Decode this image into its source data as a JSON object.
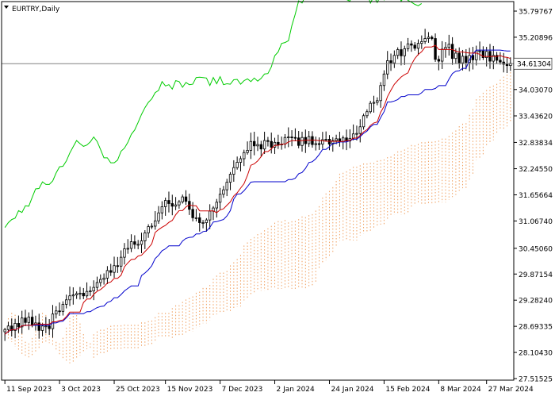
{
  "symbol_label": "EURTRY,Daily",
  "colors": {
    "background": "#ffffff",
    "frame": "#000000",
    "candle_up": "#000000",
    "candle_down": "#000000",
    "tenkan": "#cc0000",
    "kijun": "#0000cc",
    "chikou": "#00cc00",
    "cloud_bull": "#f0a060",
    "cloud_bear": "#c8a8d8",
    "current_price_line": "#808080",
    "price_box": "#ffffff"
  },
  "chart_data": {
    "type": "candlestick",
    "title": "EURTRY,Daily",
    "indicator": "Ichimoku Kinko Hyo",
    "grid": false,
    "current_price": 34.61304,
    "ylim": [
      27.51525,
      35.79767
    ],
    "y_ticks": [
      "35.79767",
      "35.20896",
      "34.61304",
      "34.03070",
      "33.43620",
      "32.83834",
      "32.24550",
      "31.65664",
      "31.06740",
      "30.45060",
      "29.87154",
      "29.28240",
      "28.69335",
      "28.10430",
      "27.51525"
    ],
    "y_tick_values": [
      35.79767,
      35.20896,
      34.61304,
      34.0307,
      33.4362,
      32.83834,
      32.2455,
      31.65664,
      31.0674,
      30.4506,
      29.87154,
      29.2824,
      28.69335,
      28.1043,
      27.51525
    ],
    "x_ticks": [
      "11 Sep 2023",
      "3 Oct 2023",
      "25 Oct 2023",
      "15 Nov 2023",
      "7 Dec 2023",
      "2 Jan 2024",
      "24 Jan 2024",
      "15 Feb 2024",
      "8 Mar 2024",
      "27 Mar 2024"
    ],
    "x_tick_bar_index": [
      0,
      16,
      32,
      47,
      63,
      79,
      95,
      111,
      127,
      141
    ],
    "bars_total": 149,
    "forward_bars": 26,
    "close": [
      28.62,
      28.7,
      28.6,
      28.76,
      28.68,
      28.88,
      28.78,
      28.9,
      28.72,
      28.77,
      28.6,
      28.7,
      28.7,
      28.64,
      28.97,
      29.04,
      29.03,
      29.19,
      29.29,
      29.38,
      29.4,
      29.43,
      29.44,
      29.38,
      29.48,
      29.49,
      29.57,
      29.68,
      29.75,
      29.78,
      29.95,
      29.91,
      30.06,
      30.05,
      30.25,
      30.44,
      30.45,
      30.6,
      30.54,
      30.54,
      30.62,
      30.8,
      30.94,
      30.95,
      31.07,
      31.25,
      31.39,
      31.53,
      31.46,
      31.4,
      31.43,
      31.5,
      31.61,
      31.51,
      31.33,
      31.14,
      31.14,
      31.03,
      31.03,
      31.09,
      31.29,
      31.36,
      31.49,
      31.67,
      31.77,
      31.94,
      32.12,
      32.27,
      32.39,
      32.47,
      32.61,
      32.66,
      32.86,
      32.76,
      32.79,
      32.69,
      32.88,
      32.86,
      32.73,
      32.84,
      32.79,
      32.8,
      32.95,
      32.96,
      32.95,
      32.94,
      32.77,
      32.95,
      32.81,
      32.97,
      32.79,
      32.81,
      32.8,
      32.9,
      32.91,
      32.8,
      32.88,
      32.92,
      32.86,
      32.94,
      32.87,
      32.93,
      33.03,
      33.04,
      33.19,
      33.44,
      33.53,
      33.72,
      33.74,
      33.78,
      34.12,
      34.38,
      34.68,
      34.63,
      34.8,
      34.93,
      34.79,
      34.95,
      35.06,
      35.03,
      34.96,
      35.07,
      35.11,
      35.18,
      35.21,
      35.18,
      34.71,
      34.67,
      34.94,
      34.98,
      35.05,
      34.73,
      34.85,
      34.63,
      34.78,
      34.64,
      34.8,
      34.7,
      34.9,
      34.9,
      34.75,
      34.89,
      34.67,
      34.8,
      34.69,
      34.65,
      34.6,
      34.57,
      34.62
    ],
    "series": [
      {
        "name": "Tenkan-sen"
      },
      {
        "name": "Kijun-sen"
      },
      {
        "name": "Senkou Span A"
      },
      {
        "name": "Senkou Span B"
      },
      {
        "name": "Chikou Span"
      }
    ]
  }
}
